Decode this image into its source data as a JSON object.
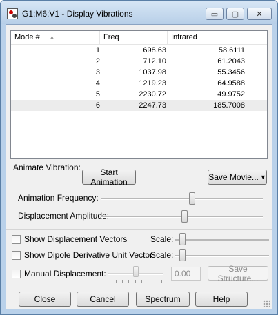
{
  "window": {
    "title": "G1:M6:V1 - Display Vibrations"
  },
  "title_buttons": {
    "minimize": "▭",
    "maximize": "▢",
    "close": "✕"
  },
  "table": {
    "headers": [
      "Mode #",
      "Freq",
      "Infrared"
    ],
    "rows": [
      {
        "mode": "1",
        "freq": "698.63",
        "ir": "58.6111"
      },
      {
        "mode": "2",
        "freq": "712.10",
        "ir": "61.2043"
      },
      {
        "mode": "3",
        "freq": "1037.98",
        "ir": "55.3456"
      },
      {
        "mode": "4",
        "freq": "1219.23",
        "ir": "64.9588"
      },
      {
        "mode": "5",
        "freq": "2230.72",
        "ir": "49.9752"
      },
      {
        "mode": "6",
        "freq": "2247.73",
        "ir": "185.7008"
      }
    ],
    "selected_row": 6
  },
  "animate": {
    "group_label": "Animate Vibration:",
    "start_button": "Start Animation",
    "save_movie_button": "Save Movie...",
    "frequency_label": "Animation Frequency:",
    "frequency_level": 0.55,
    "amplitude_label": "Displacement Amplitude:",
    "amplitude_level": 0.5
  },
  "options": {
    "show_vectors": {
      "label": "Show Displacement Vectors",
      "checked": false,
      "scale_label": "Scale:",
      "scale_level": 0.05
    },
    "show_dipole": {
      "label": "Show Dipole Derivative Unit Vector",
      "checked": false,
      "scale_label": "Scale:",
      "scale_level": 0.05
    },
    "manual": {
      "label": "Manual Displacement:",
      "checked": false,
      "value": "0.00",
      "save_structure_button": "Save Structure...",
      "slider_level": 0.5
    }
  },
  "buttons": {
    "close": "Close",
    "cancel": "Cancel",
    "spectrum": "Spectrum",
    "help": "Help"
  }
}
